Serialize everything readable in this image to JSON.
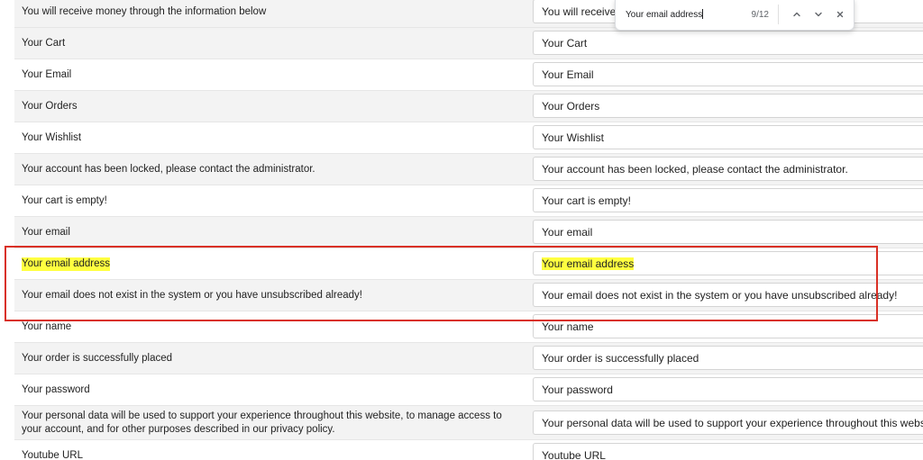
{
  "find_bar": {
    "query": "Your email address",
    "match_count": "9/12",
    "prev_icon": "chevron-up-icon",
    "next_icon": "chevron-down-icon",
    "close_icon": "close-icon"
  },
  "rows": [
    {
      "label": "You will receive money through the information below",
      "value": "You will receive money through the information below"
    },
    {
      "label": "Your Cart",
      "value": "Your Cart"
    },
    {
      "label": "Your Email",
      "value": "Your Email"
    },
    {
      "label": "Your Orders",
      "value": "Your Orders"
    },
    {
      "label": "Your Wishlist",
      "value": "Your Wishlist"
    },
    {
      "label": "Your account has been locked, please contact the administrator.",
      "value": "Your account has been locked, please contact the administrator."
    },
    {
      "label": "Your cart is empty!",
      "value": "Your cart is empty!"
    },
    {
      "label": "Your email",
      "value": "Your email"
    },
    {
      "label": "Your email address",
      "value": "Your email address"
    },
    {
      "label": "Your email does not exist in the system or you have unsubscribed already!",
      "value": "Your email does not exist in the system or you have unsubscribed already!"
    },
    {
      "label": "Your name",
      "value": "Your name"
    },
    {
      "label": "Your order is successfully placed",
      "value": "Your order is successfully placed"
    },
    {
      "label": "Your password",
      "value": "Your password"
    },
    {
      "label": "Your personal data will be used to support your experience throughout this website, to manage access to your account, and for other purposes described in our privacy policy.",
      "value": "Your personal data will be used to support your experience throughout this website, to manage access to your account, and for other purposes described in our privacy policy."
    },
    {
      "label": "Youtube URL",
      "value": "Youtube URL"
    }
  ],
  "colors": {
    "highlight": "#ffff40",
    "annotation_box": "#d93025"
  }
}
